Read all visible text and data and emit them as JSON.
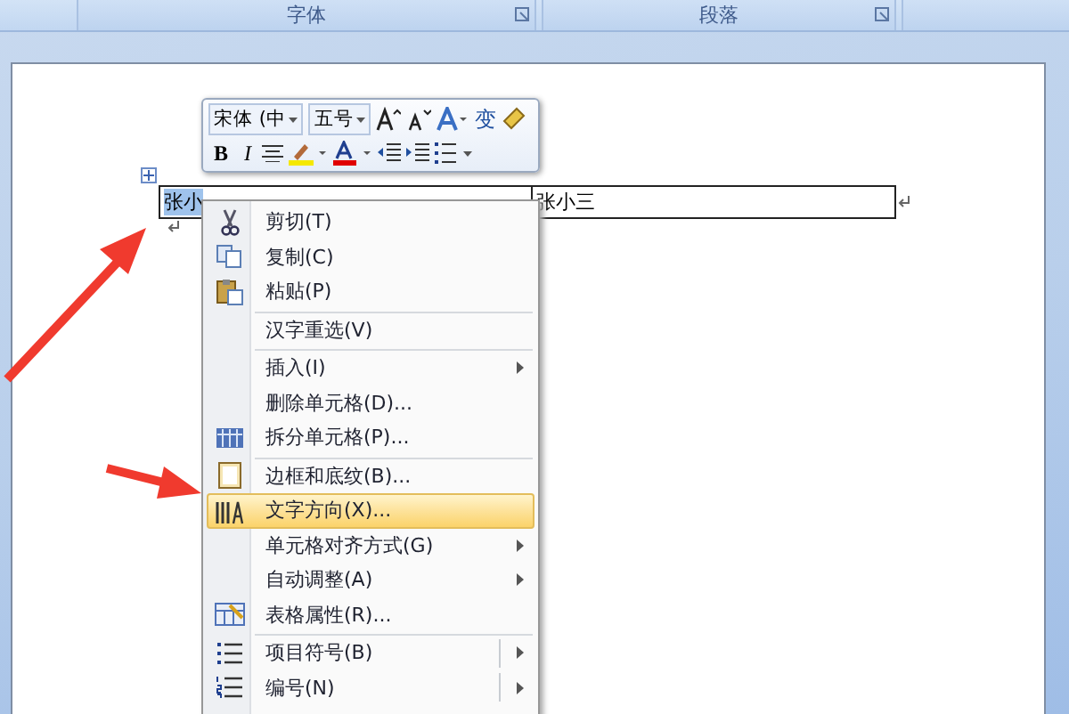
{
  "ribbon_groups": [
    {
      "label": "字体"
    },
    {
      "label": "段落"
    }
  ],
  "table": {
    "cells": [
      {
        "text": "张小",
        "selected": true
      },
      {
        "text": "张小三",
        "selected": false
      }
    ]
  },
  "mini_toolbar": {
    "font": "宋体 (中",
    "size": "五号",
    "glyph": "变",
    "bold": "B",
    "italic": "I"
  },
  "context_menu": [
    {
      "kind": "cut",
      "label": "剪切(T)",
      "separator_before": false,
      "submenu": false,
      "split": false,
      "selected": false
    },
    {
      "kind": "copy",
      "label": "复制(C)",
      "separator_before": false,
      "submenu": false,
      "split": false,
      "selected": false
    },
    {
      "kind": "paste",
      "label": "粘贴(P)",
      "separator_before": false,
      "submenu": false,
      "split": false,
      "selected": false
    },
    {
      "kind": "plain",
      "label": "汉字重选(V)",
      "separator_before": true,
      "submenu": false,
      "split": false,
      "selected": false
    },
    {
      "kind": "plain",
      "label": "插入(I)",
      "separator_before": true,
      "submenu": true,
      "split": false,
      "selected": false
    },
    {
      "kind": "plain",
      "label": "删除单元格(D)...",
      "separator_before": false,
      "submenu": false,
      "split": false,
      "selected": false
    },
    {
      "kind": "grid",
      "label": "拆分单元格(P)...",
      "separator_before": false,
      "submenu": false,
      "split": false,
      "selected": false
    },
    {
      "kind": "border",
      "label": "边框和底纹(B)...",
      "separator_before": true,
      "submenu": false,
      "split": false,
      "selected": false
    },
    {
      "kind": "direction",
      "label": "文字方向(X)...",
      "separator_before": false,
      "submenu": false,
      "split": false,
      "selected": true
    },
    {
      "kind": "plain",
      "label": "单元格对齐方式(G)",
      "separator_before": false,
      "submenu": true,
      "split": false,
      "selected": false
    },
    {
      "kind": "plain",
      "label": "自动调整(A)",
      "separator_before": false,
      "submenu": true,
      "split": false,
      "selected": false
    },
    {
      "kind": "properties",
      "label": "表格属性(R)...",
      "separator_before": false,
      "submenu": false,
      "split": false,
      "selected": false
    },
    {
      "kind": "bullets",
      "label": "项目符号(B)",
      "separator_before": true,
      "submenu": true,
      "split": true,
      "selected": false
    },
    {
      "kind": "numbering",
      "label": "编号(N)",
      "separator_before": false,
      "submenu": true,
      "split": true,
      "selected": false
    }
  ]
}
